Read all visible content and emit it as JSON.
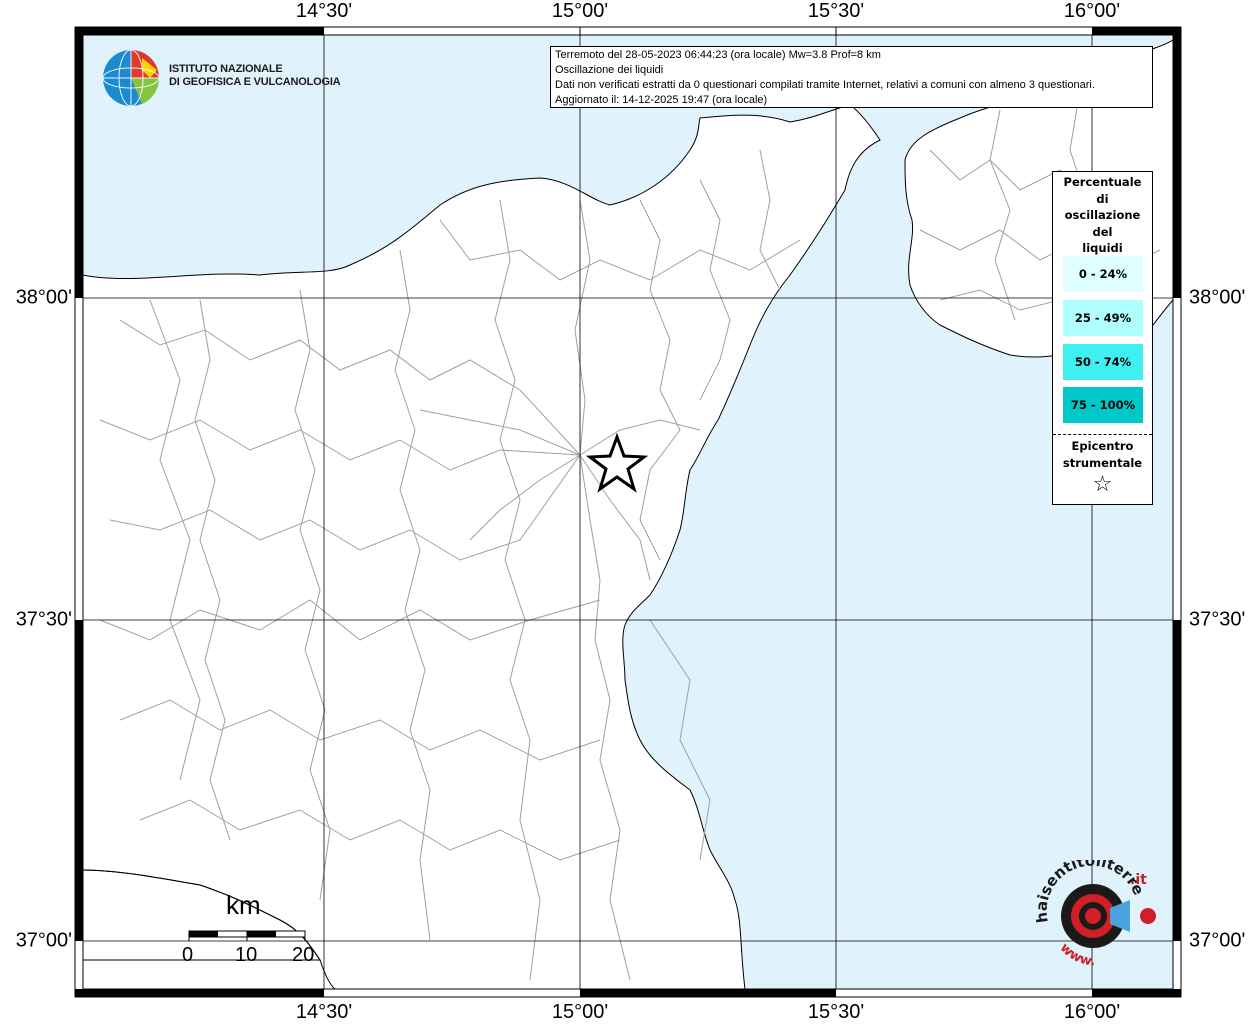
{
  "header": {
    "title_line": "Terremoto del 28-05-2023 06:44:23 (ora locale) Mw=3.8 Prof=8 km",
    "subtitle_line": "Oscillazione dei liquidi",
    "notice_line": "Dati non verificati estratti da 0 questionari compilati tramite Internet, relativi a comuni con almeno 3 questionari.",
    "updated_line": "Aggiornato il: 14-12-2025 19:47 (ora locale)"
  },
  "institute": {
    "line1": "ISTITUTO NAZIONALE",
    "line2": "DI GEOFISICA E VULCANOLOGIA"
  },
  "grid": {
    "longitude_labels": [
      "14°30'",
      "15°00'",
      "15°30'",
      "16°00'"
    ],
    "latitude_labels": [
      "38°00'",
      "37°30'",
      "37°00'"
    ]
  },
  "legend": {
    "title_lines": [
      "Percentuale",
      "di",
      "oscillazione",
      "del",
      "liquidi"
    ],
    "classes": [
      {
        "label": "0 - 24%",
        "color": "#e0ffff"
      },
      {
        "label": "25 - 49%",
        "color": "#b0ffff"
      },
      {
        "label": "50 - 74%",
        "color": "#40f0f0"
      },
      {
        "label": "75 - 100%",
        "color": "#00c8c8"
      }
    ],
    "epicenter_lines": [
      "Epicentro",
      "strumentale"
    ],
    "epicenter_symbol": "☆"
  },
  "scale_bar": {
    "unit": "km",
    "ticks": [
      "0",
      "10",
      "20"
    ]
  },
  "epicenter": {
    "lon": 15.07,
    "lat": 37.75,
    "symbol": "star-outline"
  },
  "colors": {
    "sea": "#e0f2fc",
    "land": "#ffffff",
    "boundaries": "#a0a0a0",
    "grid": "#000000"
  },
  "footer_logo": {
    "text_main": "haisentitoilterremoto",
    "text_domain": ".it",
    "text_url": "www."
  }
}
